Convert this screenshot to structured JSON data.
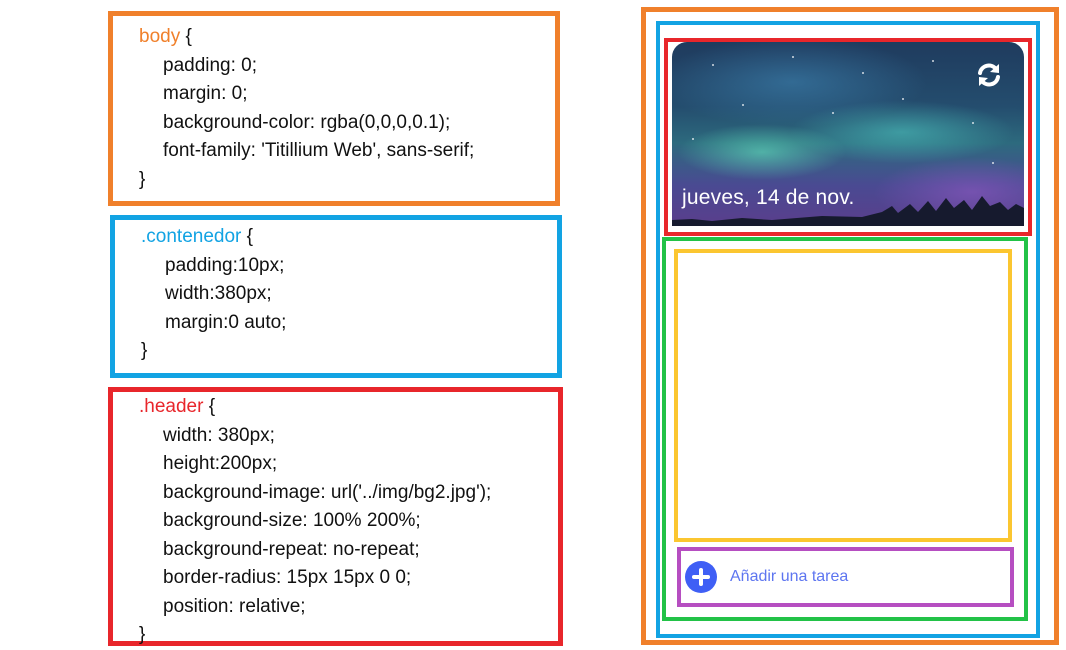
{
  "css_rules": {
    "body": {
      "selector": "body",
      "open": " {",
      "lines": [
        "padding: 0;",
        "margin: 0;",
        "background-color: rgba(0,0,0,0.1);",
        "font-family: 'Titillium Web', sans-serif;"
      ],
      "close": "}",
      "color": "#f0802b"
    },
    "contenedor": {
      "selector": ".contenedor",
      "open": " {",
      "lines": [
        "padding:10px;",
        "width:380px;",
        "margin:0 auto;"
      ],
      "close": "}",
      "color": "#12a3e3"
    },
    "header": {
      "selector": ".header",
      "open": " {",
      "lines": [
        "width: 380px;",
        "height:200px;",
        "background-image: url('../img/bg2.jpg');",
        "background-size: 100% 200%;",
        "background-repeat: no-repeat;",
        "border-radius: 15px 15px 0 0;",
        "position: relative;"
      ],
      "close": "}",
      "color": "#e8262b"
    }
  },
  "preview": {
    "date_text": "jueves, 14 de nov.",
    "refresh_icon": "refresh-icon",
    "add_icon": "plus-circle-icon",
    "add_task_label": "Añadir una tarea"
  },
  "colors": {
    "body_outline": "#f0802b",
    "contenedor_outline": "#12a3e3",
    "header_outline": "#e8262b",
    "content_outline": "#22c247",
    "list_outline": "#fbc630",
    "add_outline": "#b64ec1",
    "add_icon": "#3f5ff5",
    "add_label": "#5d75f0"
  }
}
